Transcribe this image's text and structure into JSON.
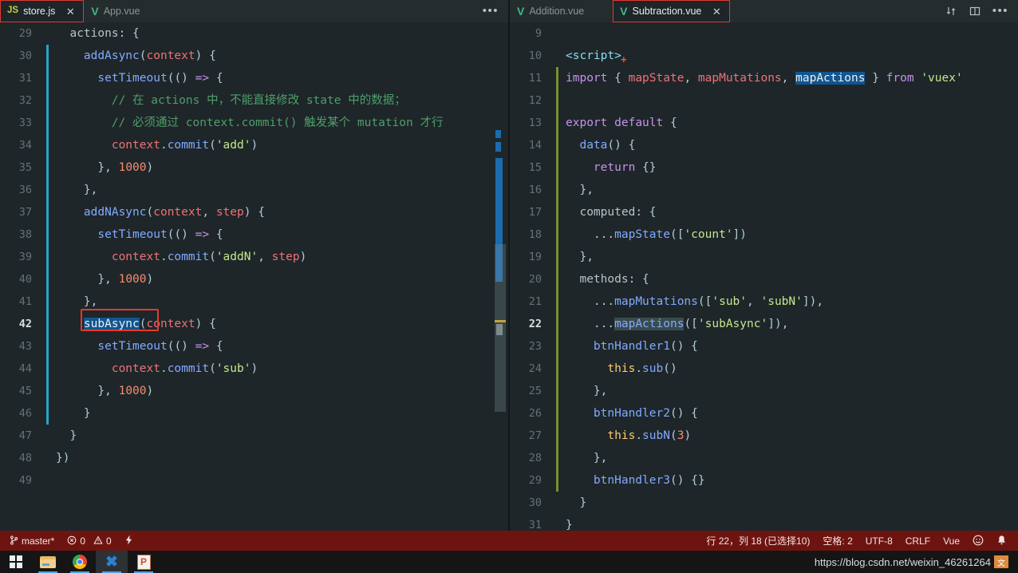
{
  "window": {
    "title": "Visual Studio Code"
  },
  "left_tabbar": {
    "tabs": [
      {
        "label": "store.js",
        "icon": "js-file-icon",
        "icon_text": "JS",
        "active": true,
        "outlined": true,
        "close": "✕"
      },
      {
        "label": "App.vue",
        "icon": "vue-file-icon",
        "icon_text": "V",
        "active": false,
        "outlined": false,
        "close": "✕"
      }
    ],
    "more_label": "•••"
  },
  "right_tabbar": {
    "tabs": [
      {
        "label": "Addition.vue",
        "icon": "vue-file-icon",
        "icon_text": "V",
        "active": false,
        "outlined": false,
        "close": "✕"
      },
      {
        "label": "Subtraction.vue",
        "icon": "vue-file-icon",
        "icon_text": "V",
        "active": true,
        "outlined": true,
        "close": "✕"
      }
    ],
    "actions": [
      "split-vertical-icon",
      "split-editor-icon",
      "more-actions-icon"
    ],
    "more_label": "•••"
  },
  "left_editor": {
    "file": "store.js",
    "first_line": 29,
    "active_line": 42,
    "lines": [
      {
        "n": 29,
        "text": "  actions: {"
      },
      {
        "n": 30,
        "text": "    addAsync(context) {"
      },
      {
        "n": 31,
        "text": "      setTimeout(() => {"
      },
      {
        "n": 32,
        "text": "        // 在 actions 中，不能直接修改 state 中的数据；"
      },
      {
        "n": 33,
        "text": "        // 必须通过 context.commit() 触发某个 mutation 才行"
      },
      {
        "n": 34,
        "text": "        context.commit('add')"
      },
      {
        "n": 35,
        "text": "      }, 1000)"
      },
      {
        "n": 36,
        "text": "    },"
      },
      {
        "n": 37,
        "text": "    addNAsync(context, step) {"
      },
      {
        "n": 38,
        "text": "      setTimeout(() => {"
      },
      {
        "n": 39,
        "text": "        context.commit('addN', step)"
      },
      {
        "n": 40,
        "text": "      }, 1000)"
      },
      {
        "n": 41,
        "text": "    },"
      },
      {
        "n": 42,
        "text": "    subAsync(context) {"
      },
      {
        "n": 43,
        "text": "      setTimeout(() => {"
      },
      {
        "n": 44,
        "text": "        context.commit('sub')"
      },
      {
        "n": 45,
        "text": "      }, 1000)"
      },
      {
        "n": 46,
        "text": "    }"
      },
      {
        "n": 47,
        "text": "  }"
      },
      {
        "n": 48,
        "text": "})"
      },
      {
        "n": 49,
        "text": ""
      }
    ],
    "selection": "subAsync",
    "annotation_box": "subAsync-highlight-box"
  },
  "right_editor": {
    "file": "Subtraction.vue",
    "first_line": 9,
    "active_line": 22,
    "lines": [
      {
        "n": 9,
        "text": ""
      },
      {
        "n": 10,
        "text": "<script>"
      },
      {
        "n": 11,
        "text": "import { mapState, mapMutations, mapActions } from 'vuex'"
      },
      {
        "n": 12,
        "text": ""
      },
      {
        "n": 13,
        "text": "export default {"
      },
      {
        "n": 14,
        "text": "  data() {"
      },
      {
        "n": 15,
        "text": "    return {}"
      },
      {
        "n": 16,
        "text": "  },"
      },
      {
        "n": 17,
        "text": "  computed: {"
      },
      {
        "n": 18,
        "text": "    ...mapState(['count'])"
      },
      {
        "n": 19,
        "text": "  },"
      },
      {
        "n": 20,
        "text": "  methods: {"
      },
      {
        "n": 21,
        "text": "    ...mapMutations(['sub', 'subN']),"
      },
      {
        "n": 22,
        "text": "    ...mapActions(['subAsync']),"
      },
      {
        "n": 23,
        "text": "    btnHandler1() {"
      },
      {
        "n": 24,
        "text": "      this.sub()"
      },
      {
        "n": 25,
        "text": "    },"
      },
      {
        "n": 26,
        "text": "    btnHandler2() {"
      },
      {
        "n": 27,
        "text": "      this.subN(3)"
      },
      {
        "n": 28,
        "text": "    },"
      },
      {
        "n": 29,
        "text": "    btnHandler3() {}"
      },
      {
        "n": 30,
        "text": "  }"
      },
      {
        "n": 31,
        "text": "}"
      }
    ],
    "selection": "mapActions",
    "word_highlight": "mapActions",
    "error_marker": "+"
  },
  "statusbar": {
    "branch": "master*",
    "branch_icon": "source-control-icon",
    "errors_icon": "error-icon",
    "errors": "0",
    "warnings_icon": "warning-icon",
    "warnings": "0",
    "radio_icon": "live-share-icon",
    "cursor_position": "行 22，列 18 (已选择10)",
    "indentation": "空格: 2",
    "encoding": "UTF-8",
    "eol": "CRLF",
    "language": "Vue",
    "feedback_icon": "smiley-icon",
    "notifications_icon": "bell-icon"
  },
  "taskbar": {
    "items": [
      {
        "name": "start-button",
        "icon": "windows-logo-icon",
        "active": false
      },
      {
        "name": "file-explorer-button",
        "icon": "folder-icon",
        "active": false
      },
      {
        "name": "chrome-button",
        "icon": "chrome-icon",
        "active": false
      },
      {
        "name": "vscode-button",
        "icon": "vscode-icon",
        "icon_text": "✖",
        "active": true
      },
      {
        "name": "powerpoint-button",
        "icon": "powerpoint-icon",
        "icon_text": "P",
        "active": false
      }
    ]
  },
  "watermark": {
    "text": "https://blog.csdn.net/weixin_46261264"
  },
  "colors": {
    "editor_bg": "#1e2629",
    "tabbar_bg": "#252c2e",
    "statusbar_bg": "#6e1410",
    "annotation_red": "#e8392b",
    "selection_blue": "#12558f",
    "accent_cyan": "#26a3c7",
    "accent_green": "#7a8f2e"
  }
}
